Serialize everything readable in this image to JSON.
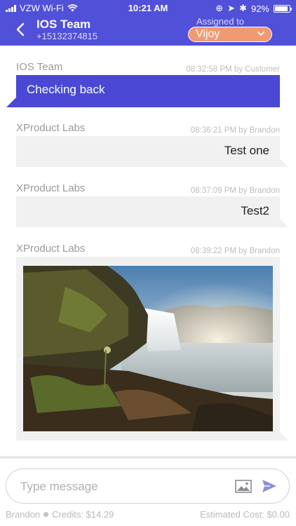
{
  "status_bar": {
    "carrier": "VZW Wi-Fi",
    "time": "10:21 AM",
    "battery": "92%",
    "battery_level": 0.92
  },
  "header": {
    "title": "IOS Team",
    "phone": "+15132374815",
    "assigned_label": "Assigned to",
    "assigned_value": "Vijoy"
  },
  "messages": [
    {
      "sender": "IOS Team",
      "meta": "08:32:58 PM by Customer",
      "text": "Checking back",
      "direction": "out"
    },
    {
      "sender": "XProduct Labs",
      "meta": "08:36:21 PM by Brandon",
      "text": "Test one",
      "direction": "in"
    },
    {
      "sender": "XProduct Labs",
      "meta": "08:37:09 PM by Brandon",
      "text": "Test2",
      "direction": "in"
    },
    {
      "sender": "XProduct Labs",
      "meta": "08:39:22 PM by Brandon",
      "type": "image",
      "direction": "in"
    }
  ],
  "composer": {
    "placeholder": "Type message"
  },
  "footer": {
    "user": "Brandon",
    "credits": "Credits: $14.29",
    "estimated_cost": "Estimated Cost: $0.00"
  },
  "colors": {
    "accent": "#5150d9",
    "outgoing_bubble": "#4a48d4",
    "incoming_bubble": "#f1f1f1",
    "assign_pill": "#f19a72"
  }
}
